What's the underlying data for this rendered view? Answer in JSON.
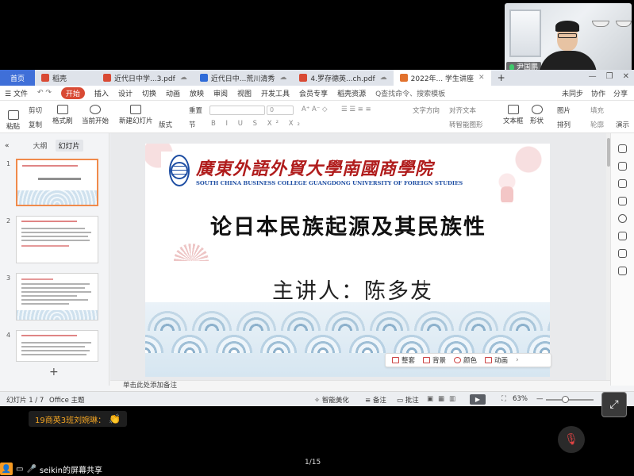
{
  "meeting": {
    "participant_name": "尹国鹏",
    "chat_message": "19商英3班刘婉琳：",
    "chat_emoji": "👏",
    "share_label": "seikin的屏幕共享",
    "page_indicator": "1/15"
  },
  "tabs": [
    {
      "label": "首页",
      "kind": "home"
    },
    {
      "label": "稻壳",
      "icon_color": "#d94a34"
    },
    {
      "label": "近代日中学...3.pdf",
      "icon_color": "#d94a34"
    },
    {
      "label": "近代日中...荒川清秀",
      "icon_color": "#2f6bd8"
    },
    {
      "label": "4.罗存德英...ch.pdf",
      "icon_color": "#d94a34"
    },
    {
      "label": "2022年... 学生讲座",
      "icon_color": "#e2722e",
      "active": true
    }
  ],
  "menu": {
    "file": "文件",
    "items": [
      "开始",
      "插入",
      "设计",
      "切换",
      "动画",
      "放映",
      "审阅",
      "视图",
      "开发工具",
      "会员专享",
      "稻壳资源"
    ],
    "search": "Q查找命令、搜索模板",
    "right": [
      "未同步",
      "协作",
      "分享"
    ]
  },
  "ribbon": {
    "paste": "粘贴",
    "cut": "剪切",
    "copy": "复制",
    "format_painter": "格式刷",
    "play_current": "当前开始",
    "new_slide": "新建幻灯片",
    "layout": "版式",
    "section": "节",
    "reset": "重置",
    "font_size": "0",
    "text_direction": "文字方向",
    "align_text": "对齐文本",
    "smartart": "转智能图形",
    "textbox": "文本框",
    "shape": "形状",
    "picture": "图片",
    "fill": "填充",
    "arrange": "排列",
    "outline": "轮廓",
    "more": "演示"
  },
  "panel": {
    "outline_tab": "大纲",
    "slides_tab": "幻灯片",
    "slide_numbers": [
      "1",
      "2",
      "3",
      "4"
    ],
    "add": "+"
  },
  "slide": {
    "school_cn": "廣東外語外貿大學南國商學院",
    "school_en": "SOUTH CHINA BUSINESS COLLEGE GUANGDONG UNIVERSITY OF FOREIGN STUDIES",
    "title": "论日本民族起源及其民族性",
    "presenter": "主讲人：陈多友"
  },
  "slide_toolbar": [
    "整套",
    "背景",
    "颜色",
    "动画"
  ],
  "notes_placeholder": "单击此处添加备注",
  "status": {
    "slide_count": "幻灯片 1 / 7",
    "theme": "Office 主题",
    "beautify": "智能美化",
    "notes": "备注",
    "comments": "批注",
    "zoom": "63%"
  }
}
